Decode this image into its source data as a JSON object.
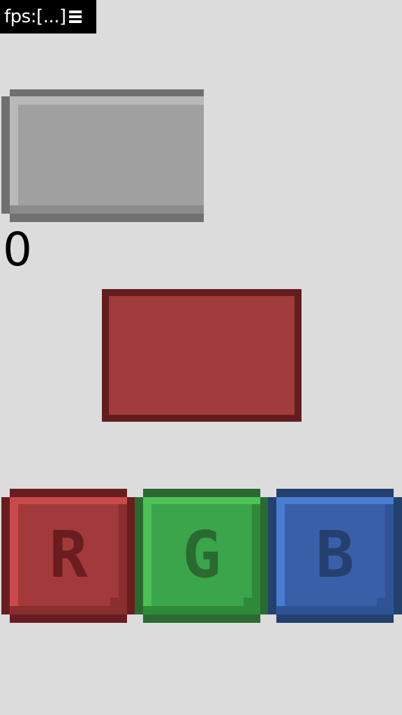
{
  "hud": {
    "fps_label": "fps:[...]",
    "menu_icon": "hamburger-menu-icon"
  },
  "score": "0",
  "target_color": "#a0a0a0",
  "current_color": "#a13b3c",
  "buttons": [
    {
      "label": "R",
      "color": "#a23a3b"
    },
    {
      "label": "G",
      "color": "#3aa54a"
    },
    {
      "label": "B",
      "color": "#395fa8"
    }
  ]
}
